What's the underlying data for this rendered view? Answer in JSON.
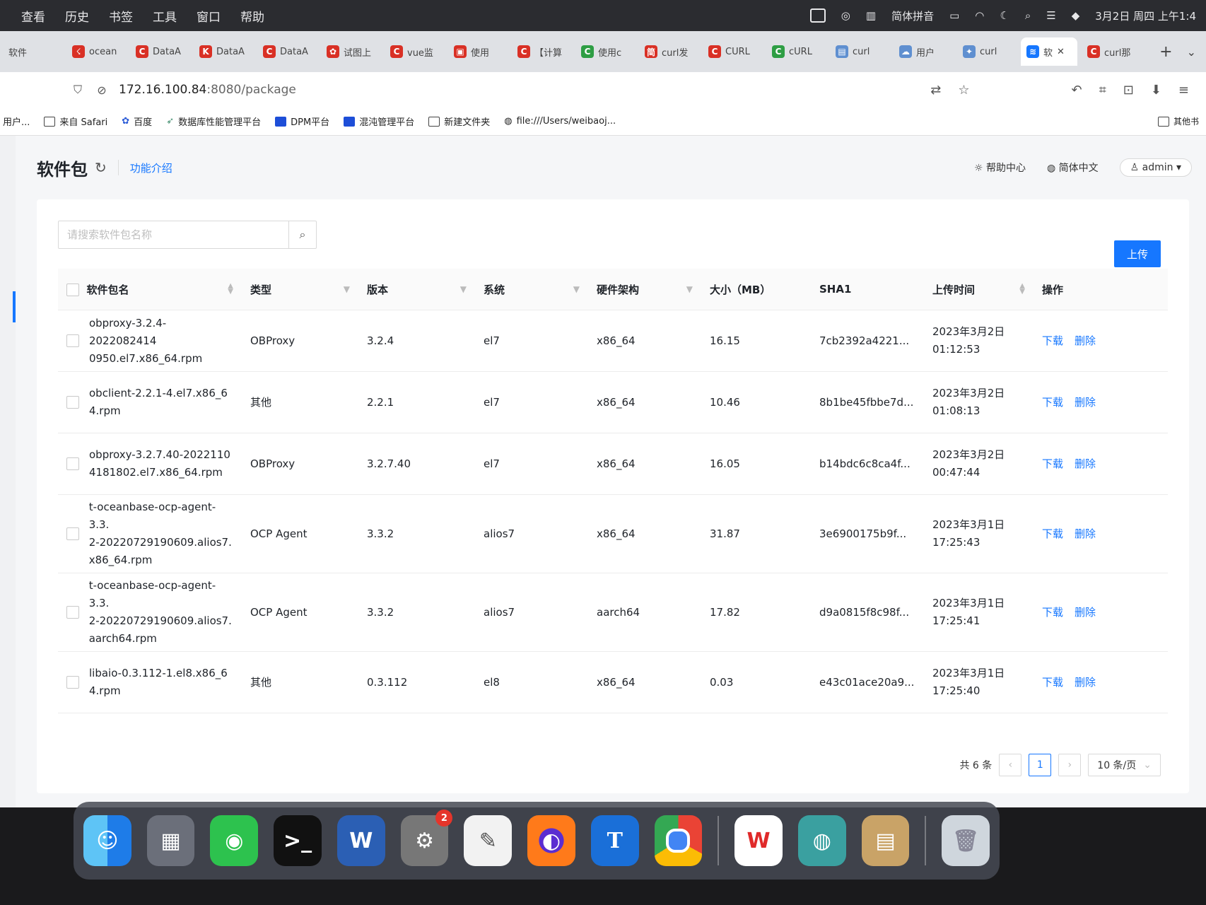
{
  "menubar": {
    "menus": [
      "查看",
      "历史",
      "书签",
      "工具",
      "窗口",
      "帮助"
    ],
    "status": {
      "input_method": "简体拼音",
      "datetime": "3月2日 周四 上午1:4"
    }
  },
  "tabs": [
    {
      "label": "软件"
    },
    {
      "label": "ocean"
    },
    {
      "label": "DataA"
    },
    {
      "label": "DataA"
    },
    {
      "label": "DataA"
    },
    {
      "label": "试图上"
    },
    {
      "label": "vue监"
    },
    {
      "label": "使用"
    },
    {
      "label": "【计算"
    },
    {
      "label": "使用c"
    },
    {
      "label": "curl发"
    },
    {
      "label": "CURL"
    },
    {
      "label": "cURL"
    },
    {
      "label": "curl"
    },
    {
      "label": "用户"
    },
    {
      "label": "curl"
    },
    {
      "label": "软"
    },
    {
      "label": "curl那"
    }
  ],
  "address": {
    "host": "172.16.100.84",
    "path": ":8080/package"
  },
  "bookmarks": {
    "items": [
      "用户...",
      "来自 Safari",
      "百度",
      "数据库性能管理平台",
      "DPM平台",
      "混沌管理平台",
      "新建文件夹",
      "file:///Users/weibaoj..."
    ],
    "other": "其他书"
  },
  "page": {
    "title": "软件包",
    "intro_link": "功能介绍",
    "help_center": "帮助中心",
    "language": "简体中文",
    "user": "admin"
  },
  "search": {
    "placeholder": "请搜索软件包名称",
    "value": ""
  },
  "upload_label": "上传",
  "table": {
    "columns": {
      "name": "软件包名",
      "type": "类型",
      "version": "版本",
      "os": "系统",
      "arch": "硬件架构",
      "size": "大小（MB）",
      "sha1": "SHA1",
      "upload_time": "上传时间",
      "actions": "操作"
    },
    "action_download": "下载",
    "action_delete": "删除",
    "rows": [
      {
        "name_lines": [
          "obproxy-3.2.4-2022082414",
          "0950.el7.x86_64.rpm",
          ""
        ],
        "type": "OBProxy",
        "version": "3.2.4",
        "os": "el7",
        "arch": "x86_64",
        "size": "16.15",
        "sha1": "7cb2392a4221...",
        "date": "2023年3月2日",
        "time": "01:12:53"
      },
      {
        "name_lines": [
          "obclient-2.2.1-4.el7.x86_6",
          "4.rpm",
          ""
        ],
        "type": "其他",
        "version": "2.2.1",
        "os": "el7",
        "arch": "x86_64",
        "size": "10.46",
        "sha1": "8b1be45fbbe7d...",
        "date": "2023年3月2日",
        "time": "01:08:13"
      },
      {
        "name_lines": [
          "obproxy-3.2.7.40-2022110",
          "4181802.el7.x86_64.rpm",
          ""
        ],
        "type": "OBProxy",
        "version": "3.2.7.40",
        "os": "el7",
        "arch": "x86_64",
        "size": "16.05",
        "sha1": "b14bdc6c8ca4f...",
        "date": "2023年3月2日",
        "time": "00:47:44"
      },
      {
        "name_lines": [
          "t-oceanbase-ocp-agent-3.3.",
          "2-20220729190609.alios7.",
          "x86_64.rpm"
        ],
        "type": "OCP Agent",
        "version": "3.3.2",
        "os": "alios7",
        "arch": "x86_64",
        "size": "31.87",
        "sha1": "3e6900175b9f...",
        "date": "2023年3月1日",
        "time": "17:25:43"
      },
      {
        "name_lines": [
          "t-oceanbase-ocp-agent-3.3.",
          "2-20220729190609.alios7.",
          "aarch64.rpm"
        ],
        "type": "OCP Agent",
        "version": "3.3.2",
        "os": "alios7",
        "arch": "aarch64",
        "size": "17.82",
        "sha1": "d9a0815f8c98f...",
        "date": "2023年3月1日",
        "time": "17:25:41"
      },
      {
        "name_lines": [
          "libaio-0.3.112-1.el8.x86_6",
          "4.rpm",
          ""
        ],
        "type": "其他",
        "version": "0.3.112",
        "os": "el8",
        "arch": "x86_64",
        "size": "0.03",
        "sha1": "e43c01ace20a9...",
        "date": "2023年3月1日",
        "time": "17:25:40"
      }
    ]
  },
  "pagination": {
    "total": "共 6 条",
    "current": "1",
    "page_size": "10 条/页"
  },
  "dock": {
    "settings_badge": "2",
    "textedit_letter": "T"
  }
}
